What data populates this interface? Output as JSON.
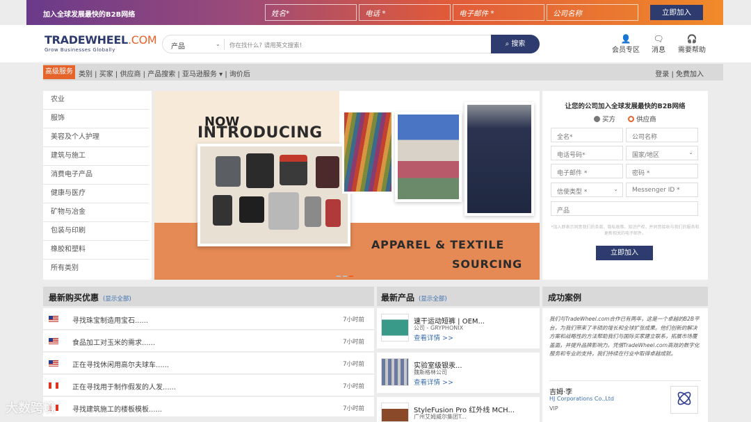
{
  "top_banner": {
    "tagline": "加入全球发展最快的B2B网络",
    "fields": [
      "姓名*",
      "电话 *",
      "电子邮件 *",
      "公司名称"
    ],
    "join_label": "立即加入"
  },
  "header": {
    "logo_main": "TRADEWHEEL",
    "logo_suffix": ".COM",
    "logo_tagline": "Grow Businesses Globally",
    "search_category": "产品",
    "search_placeholder": "你在找什么? 请用英文搜索!",
    "search_button": "搜索",
    "icons": [
      {
        "icon": "user-icon",
        "label": "会员专区"
      },
      {
        "icon": "message-icon",
        "label": "消息"
      },
      {
        "icon": "headset-icon",
        "label": "需要帮助"
      }
    ]
  },
  "navbar": {
    "premium": "高级服务",
    "items": [
      "类别",
      "买家",
      "供应商",
      "产品搜索",
      "亚马逊服务 ▾",
      "询价后"
    ],
    "login": "登录",
    "register": "免费加入"
  },
  "categories": [
    "农业",
    "服饰",
    "美容及个人护理",
    "建筑与施工",
    "消费电子产品",
    "健康与医疗",
    "矿物与冶金",
    "包装与印刷",
    "橡胶和塑料",
    "所有类别"
  ],
  "hero": {
    "now": "NOW",
    "introducing": "INTRODUCING",
    "apparel": "APPAREL & TEXTILE",
    "sourcing": "SOURCING"
  },
  "register": {
    "title": "让您的公司加入全球发展最快的B2B网络",
    "radio_buyer": "买方",
    "radio_supplier": "供应商",
    "full_name": "全名*",
    "company": "公司名称",
    "phone": "电话号码*",
    "country": "国家/地区",
    "email": "电子邮件 *",
    "password": "密码 *",
    "messenger_type": "信使类型 *",
    "messenger_id": "Messenger ID *",
    "product": "产品",
    "note": "*加入即表示同意我们的条款、隐私政策、知识产权，并同意接收与我们的服务和更新相关的电子邮件。",
    "join": "立即加入"
  },
  "deals": {
    "title": "最新购买优惠",
    "more": "(显示全部)",
    "rows": [
      {
        "flag": "us",
        "text": "寻找珠宝制造用宝石......",
        "time": "7小时前"
      },
      {
        "flag": "us",
        "text": "食品加工对玉米的需求......",
        "time": "7小时前"
      },
      {
        "flag": "us",
        "text": "正在寻找休闲用高尔夫球车......",
        "time": "7小时前"
      },
      {
        "flag": "ca",
        "text": "正在寻找用于制作假发的人发......",
        "time": "7小时前"
      },
      {
        "flag": "ca",
        "text": "寻找建筑施工的楼板模板......",
        "time": "7小时前"
      }
    ]
  },
  "products": {
    "title": "最新产品",
    "more": "(显示全部)",
    "items": [
      {
        "name": "速干运动短裤 | OEM...",
        "company": "公司 - GRYPHONIX",
        "link": "查看详情 >>"
      },
      {
        "name": "实验室级银汞...",
        "company": "魏斯格林公司",
        "link": "查看详情 >>"
      },
      {
        "name": "StyleFusion Pro 红外线 MCH...",
        "company": "广州艾姆威尔集团T...",
        "link": ""
      }
    ]
  },
  "success": {
    "title": "成功案例",
    "quote": "我们与TradeWheel.com合作已有两年，这是一个卓越的B2B平台，为我们带来了丰硕的增长和全球扩张成果。他们创新的解决方案和战略性的方法帮助我们与国际买家建立联系，拓展市场覆盖面，并提升品牌影响力。凭借TradeWheel.com高效的数字化服务和专业的支持，我们持续在行业中取得卓越成就。",
    "person": "吉姆·李",
    "company": "HJ Corporations Co.,Ltd",
    "tier": "VIP"
  },
  "watermark": "大数跨境",
  "colors": {
    "navy": "#2d3b6e",
    "orange": "#e6632a",
    "link": "#3a6fb0"
  }
}
